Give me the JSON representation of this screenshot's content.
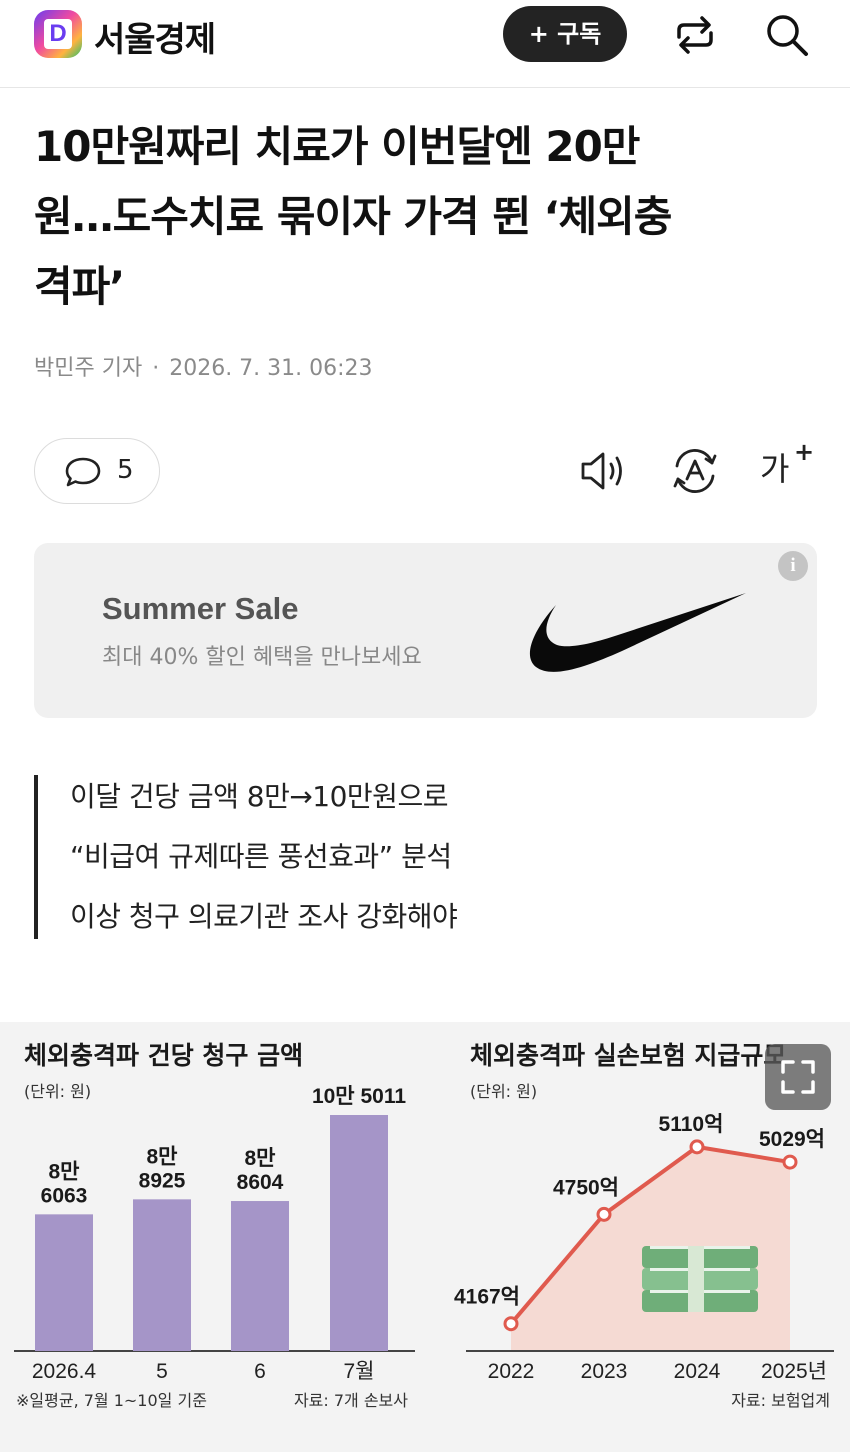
{
  "header": {
    "logo_letter": "D",
    "brand": "서울경제",
    "subscribe_label": "+ 구독",
    "icons": [
      "share-icon",
      "search-icon"
    ]
  },
  "article": {
    "headline_lines": [
      "10만원짜리 치료가 이번달엔 20만",
      "원…도수치료 묶이자 가격 뛴 ‘체외충",
      "격파’"
    ],
    "author": "박민주 기자",
    "separator": "·",
    "timestamp": "2026. 7. 31. 06:23",
    "comment_count": "5",
    "action_icons": [
      "speaker-icon",
      "translate-icon",
      "font-size-icon"
    ],
    "font_size_glyph": "가",
    "summary": [
      "이달 건당 금액 8만→10만원으로",
      "“비급여 규제따른 풍선효과” 분석",
      "이상 청구 의료기관 조사 강화해야"
    ]
  },
  "ad": {
    "title": "Summer Sale",
    "subtitle": "최대 40% 할인 혜택을 만나보세요",
    "info_glyph": "i",
    "brand_mark": "swoosh-logo"
  },
  "colors": {
    "bar": "#a595c8",
    "line": "#e05a4e",
    "area": "#f6d2c8",
    "subscribe_bg": "#232323"
  },
  "chart_data": [
    {
      "type": "bar",
      "title": "체외충격파 건당 청구 금액",
      "unit_note": "(단위: 원)",
      "categories": [
        "2026.4",
        "5",
        "6",
        "7월"
      ],
      "values": [
        86063,
        88925,
        88604,
        105011
      ],
      "value_labels": [
        [
          "8만",
          "6063"
        ],
        [
          "8만",
          "8925"
        ],
        [
          "8만",
          "8604"
        ],
        [
          "10만 5011"
        ]
      ],
      "footnote": "※일평균, 7월 1~10일 기준",
      "source": "자료: 7개 손보사"
    },
    {
      "type": "line",
      "title": "체외충격파 실손보험 지급규모",
      "unit_note": "(단위: 원)",
      "x": [
        "2022",
        "2023",
        "2024",
        "2025년"
      ],
      "values": [
        4167,
        4750,
        5110,
        5029
      ],
      "value_labels": [
        "4167억",
        "4750억",
        "5110억",
        "5029억"
      ],
      "source": "자료: 보험업계"
    }
  ]
}
